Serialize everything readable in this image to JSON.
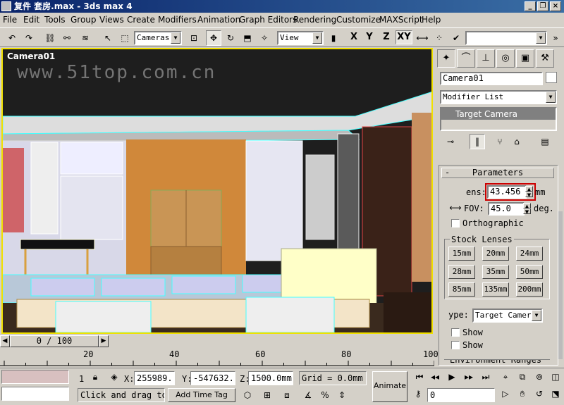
{
  "window": {
    "title": "复件 套房.max - 3ds max 4"
  },
  "menu": [
    "File",
    "Edit",
    "Tools",
    "Group",
    "Views",
    "Create",
    "Modifiers",
    "Animation",
    "Graph Editors",
    "Rendering",
    "Customize",
    "MAXScript",
    "Help"
  ],
  "toolbar": {
    "coord_system": "Cameras",
    "view": "View",
    "axis_x": "X",
    "axis_y": "Y",
    "axis_z": "Z",
    "axis_xy": "XY",
    "selection_set": ""
  },
  "viewport": {
    "label": "Camera01",
    "watermark": "www.51top.com.cn"
  },
  "command_panel": {
    "object_name": "Camera01",
    "modifier_list": "Modifier List",
    "stack_item": "Target Camera",
    "parameters": {
      "header": "Parameters",
      "lens_label": "ens:",
      "lens_value": "43.456",
      "lens_unit": "mm",
      "fov_label": "FOV:",
      "fov_value": "45.0",
      "fov_unit": "deg.",
      "orthographic": "Orthographic",
      "stock_lenses_label": "Stock Lenses",
      "stock_lenses": [
        "15mm",
        "20mm",
        "24mm",
        "28mm",
        "35mm",
        "50mm",
        "85mm",
        "135mm",
        "200mm"
      ],
      "type_label": "ype:",
      "type_value": "Target Camera",
      "show_1": "Show",
      "show_2": "Show",
      "env_ranges": "Environment Ranges"
    }
  },
  "time": {
    "frame_display": "0 / 100",
    "tick_labels": [
      "20",
      "40",
      "60",
      "80",
      "100"
    ]
  },
  "status": {
    "selected_count": "1",
    "x_label": "X:",
    "x_value": "255989.",
    "y_label": "Y:",
    "y_value": "-547632.",
    "z_label": "Z:",
    "z_value": "1500.0mm",
    "grid": "Grid = 0.0mm",
    "prompt": "Click and drag to",
    "add_time_tag": "Add Time Tag",
    "animate": "Animate",
    "current_frame": "0"
  },
  "colors": {
    "viewport_border": "#f0e000",
    "title_gradient_start": "#0a246a",
    "highlight_box": "#cc0000",
    "stack_selected": "#808080"
  }
}
